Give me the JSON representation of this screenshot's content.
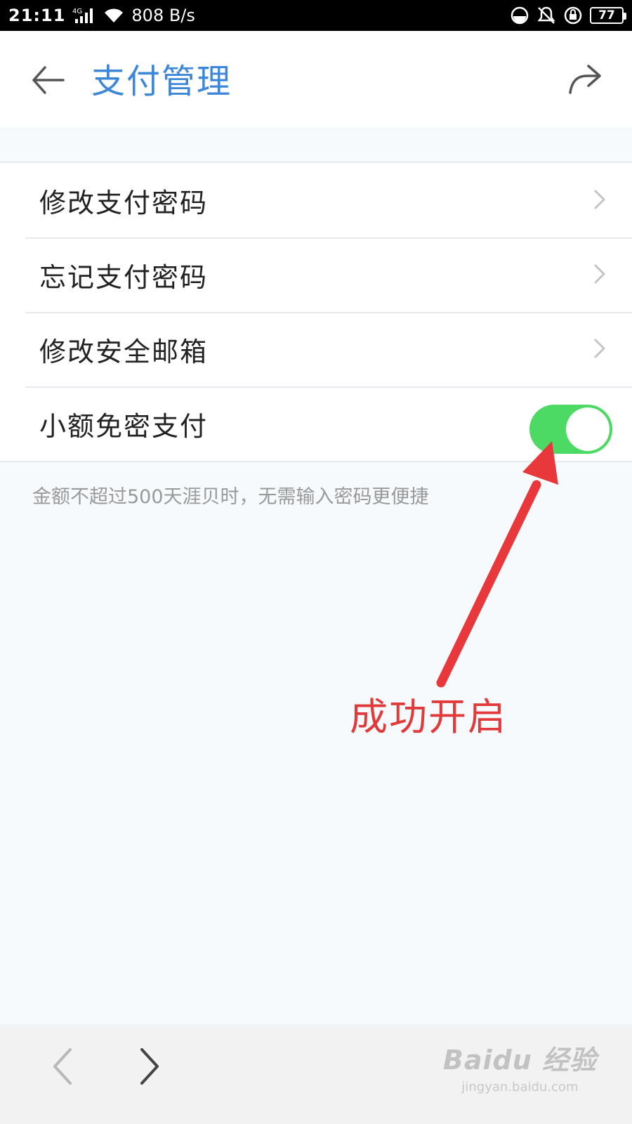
{
  "status_bar": {
    "time": "21:11",
    "network": "4G",
    "speed": "808 B/s",
    "battery": "77",
    "icons": [
      "signal-icon",
      "wifi-icon",
      "data-saver-icon",
      "alarm-muted-icon",
      "rotation-lock-icon",
      "battery-icon"
    ]
  },
  "header": {
    "title": "支付管理",
    "back_icon": "back-arrow-icon",
    "share_icon": "share-icon",
    "title_color": "#3d87d8"
  },
  "settings": {
    "items": [
      {
        "label": "修改支付密码",
        "control": "chevron"
      },
      {
        "label": "忘记支付密码",
        "control": "chevron"
      },
      {
        "label": "修改安全邮箱",
        "control": "chevron"
      },
      {
        "label": "小额免密支付",
        "control": "toggle",
        "toggle_on": true
      }
    ],
    "hint": "金额不超过500天涯贝时，无需输入密码更便捷",
    "toggle_color": "#4cd964"
  },
  "annotation": {
    "text": "成功开启",
    "color": "#e23a3a"
  },
  "bottom_nav": {
    "back_icon": "chevron-left-icon",
    "forward_icon": "chevron-right-icon"
  },
  "watermark": {
    "logo": "Baidu 经验",
    "url": "jingyan.baidu.com"
  }
}
